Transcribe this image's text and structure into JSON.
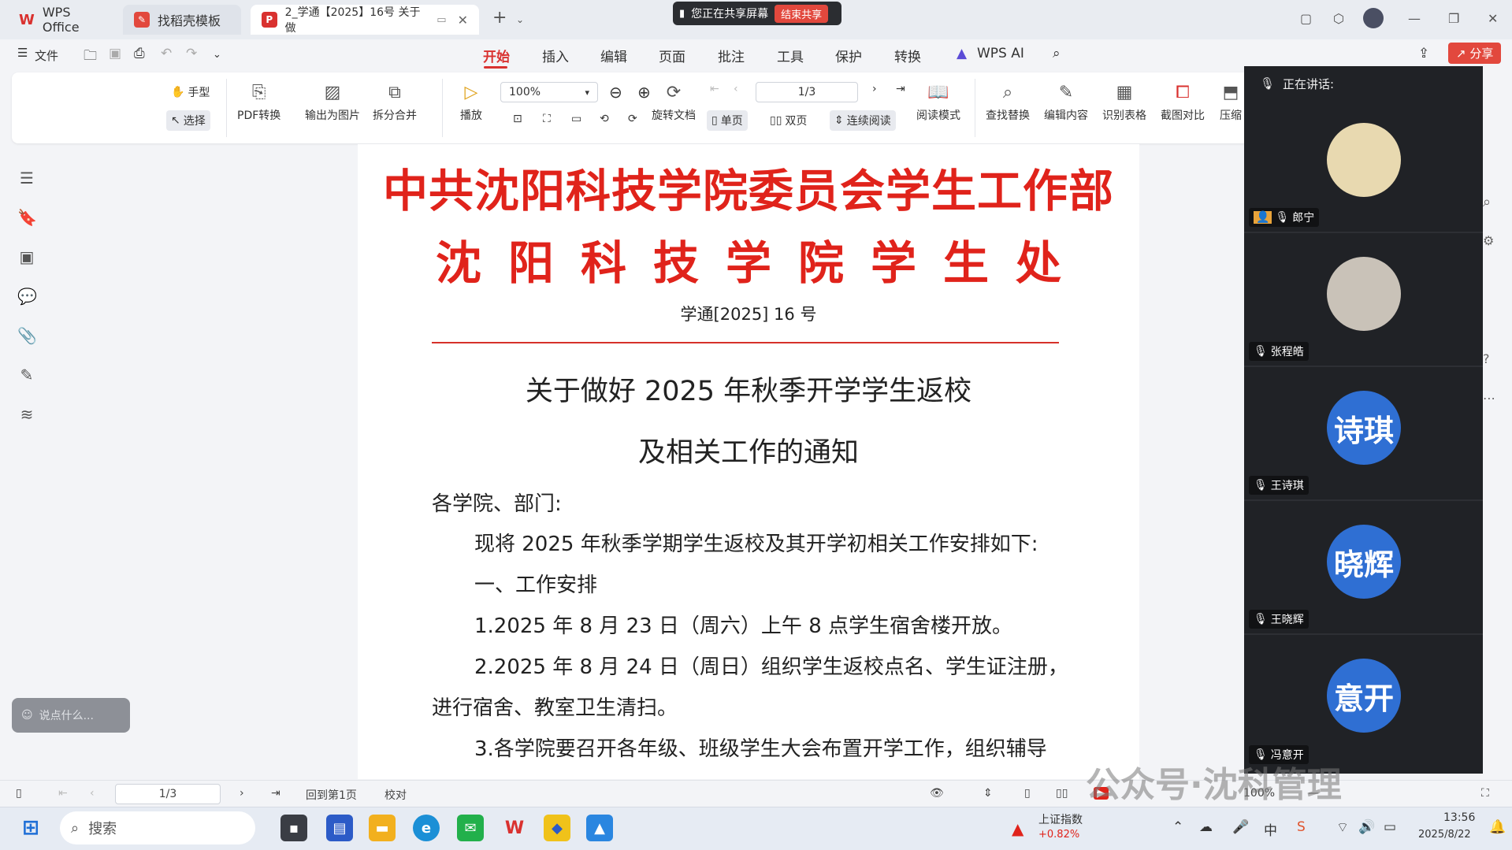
{
  "tabs": [
    {
      "label": "WPS Office",
      "icon": "wps-logo"
    },
    {
      "label": "找稻壳模板",
      "icon": "docer-icon"
    },
    {
      "label": "2_学通【2025】16号 关于做",
      "icon": "pdf-icon"
    }
  ],
  "share_banner": {
    "text": "您正在共享屏幕",
    "stop": "结束共享"
  },
  "menu": {
    "file": "文件",
    "items": [
      "开始",
      "插入",
      "编辑",
      "页面",
      "批注",
      "工具",
      "保护",
      "转换"
    ],
    "ai": "WPS AI",
    "share": "分享"
  },
  "ribbon": {
    "hand": "手型",
    "select": "选择",
    "pdf_convert": "PDF转换",
    "export_image": "输出为图片",
    "split_merge": "拆分合并",
    "play": "播放",
    "zoom": "100%",
    "rotate": "旋转文档",
    "page_field": "1/3",
    "single": "单页",
    "double": "双页",
    "continuous": "连续阅读",
    "reading": "阅读模式",
    "find_replace": "查找替换",
    "edit_content": "编辑内容",
    "recognize_table": "识别表格",
    "compare": "截图对比",
    "compress": "压缩"
  },
  "document": {
    "header1": "中共沈阳科技学院委员会学生工作部",
    "header2": "沈阳科技学院学生处",
    "doc_number": "学通[2025] 16 号",
    "title1": "关于做好 2025 年秋季开学学生返校",
    "title2": "及相关工作的通知",
    "greeting": "各学院、部门:",
    "p1": "现将 2025 年秋季学期学生返校及其开学初相关工作安排如下:",
    "p2": "一、工作安排",
    "p3": "1.2025 年 8 月 23 日（周六）上午 8 点学生宿舍楼开放。",
    "p4a": "2.2025 年 8 月 24 日（周日）组织学生返校点名、学生证注册，",
    "p4b": "进行宿舍、教室卫生清扫。",
    "p5": "3.各学院要召开各年级、班级学生大会布置开学工作，组织辅导"
  },
  "meeting": {
    "speaking": "正在讲话:",
    "participants": [
      {
        "name": "郎宁",
        "avatar_text": "",
        "color": "#e8d9b0"
      },
      {
        "name": "张程皓",
        "avatar_text": "",
        "color": "#c9c2b8"
      },
      {
        "name": "王诗琪",
        "avatar_text": "诗琪",
        "color": "#2f6fd3"
      },
      {
        "name": "王晓辉",
        "avatar_text": "晓辉",
        "color": "#2f6fd3"
      },
      {
        "name": "冯意开",
        "avatar_text": "意开",
        "color": "#2f6fd3"
      }
    ]
  },
  "chat_placeholder": "说点什么...",
  "statusbar": {
    "page": "1/3",
    "back_first": "回到第1页",
    "proofread": "校对",
    "zoom": "100%"
  },
  "taskbar": {
    "search": "搜索",
    "stock_name": "上证指数",
    "stock_change": "+0.82%",
    "time": "13:56",
    "date": "2025/8/22"
  },
  "watermark": "公众号·沈科管理",
  "colors": {
    "accent": "#d9312f",
    "doc_red": "#e0231b",
    "avatar_blue": "#2f6fd3"
  }
}
